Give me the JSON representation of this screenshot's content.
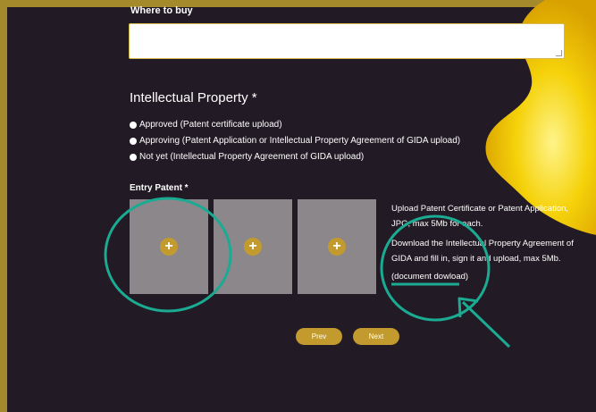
{
  "colors": {
    "background": "#221a24",
    "frame": "#a58a2c",
    "accent_gold": "#c29a2e",
    "upload_box": "#8b878b",
    "annotation": "#1aab92",
    "blob": "#f5d20a"
  },
  "where_to_buy": {
    "label": "Where to buy",
    "value": ""
  },
  "intellectual_property": {
    "title": "Intellectual Property *",
    "options": [
      "Approved (Patent certificate upload)",
      "Approving (Patent Application or Intellectual Property Agreement of GIDA upload)",
      "Not yet (Intellectual Property Agreement of GIDA upload)"
    ]
  },
  "patent": {
    "label": "Entry Patent *",
    "upload_icon": "plus-icon",
    "info_lines": [
      "Upload Patent Certificate or Patent Application,",
      "JPG, max 5Mb for each.",
      "Download the Intellectual Property Agreement of",
      "GIDA and fill in, sign it and upload, max 5Mb."
    ],
    "document_link": "(document dowload)"
  },
  "navigation": {
    "prev_label": "Prev",
    "next_label": "Next"
  }
}
